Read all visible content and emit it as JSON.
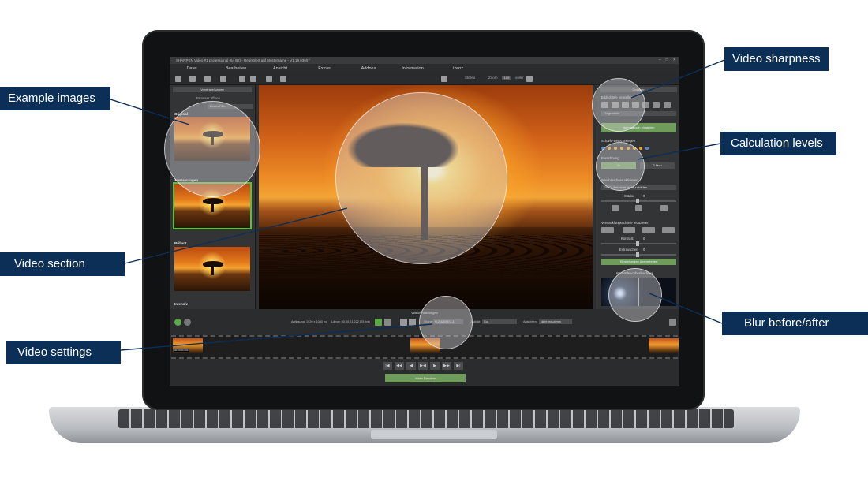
{
  "callouts": {
    "example_images": "Example images",
    "video_section": "Video section",
    "video_settings": "Video settings",
    "video_sharpness": "Video sharpness",
    "calculation_levels": "Calculation levels",
    "blur_before_after": "Blur before/after"
  },
  "app": {
    "title": "SHARPEN Video #1 professional (64 Bit) - Registriert auf Mustername - V1.19.03607",
    "menu": [
      "Datei",
      "Bearbeiten",
      "Ansicht",
      "Extras",
      "Addons",
      "Information",
      "Lizenz"
    ],
    "toolbar": {
      "stereo_label": "Stereo",
      "zoom_label": "Zoom",
      "zoom_value": "100",
      "video_label": "voller"
    }
  },
  "left_panel": {
    "header": "Voreinstellungen",
    "options_label": "Browser öffnen",
    "select_value": "Lesen Filter",
    "thumbs": [
      "Original",
      "Ausreisungen",
      "Brillant",
      "Intensiv"
    ]
  },
  "right_panel": {
    "header": "Optionen",
    "sharpness_title": "Bildschärfe einstellen",
    "sharpness_select": "Originalbild",
    "ai_button": "Automatisch einstellen",
    "levels_title": "Schärfe-Berechnungen",
    "calc_label": "Berechnung",
    "calc_btn_1": "1x",
    "calc_btn_2": "2-fach",
    "blur_title": "Weichzeichner aktivieren",
    "blur_select": "Große Bereiche leicht schärfen",
    "strength_label": "Stärke",
    "strength_value": "0",
    "denoise_title": "Verwacklungsschärfe reduzieren",
    "contrast_label": "Kontrast",
    "contrast_value": "0",
    "noise_label": "Entrauschen",
    "noise_value": "0",
    "apply_button": "Einstellungen übernehmen",
    "preview_title": "Unschärfe vorher/nachher"
  },
  "bottom": {
    "title": "Videoeinstellungen",
    "resolution": "Auflösung: 1920 x 1080 px",
    "length": "Länge: 00:00:21.222 (25 fps)",
    "format_label": "Ordner:",
    "format_value": "H.264/MPEG-4",
    "quality_label": "Qualität:",
    "quality_value": "Gut",
    "audio_label": "Ansichten:",
    "audio_value": "Nicht reduzieren",
    "timeline_label": "00:00:00.000",
    "render_button": "Video Rendern"
  }
}
